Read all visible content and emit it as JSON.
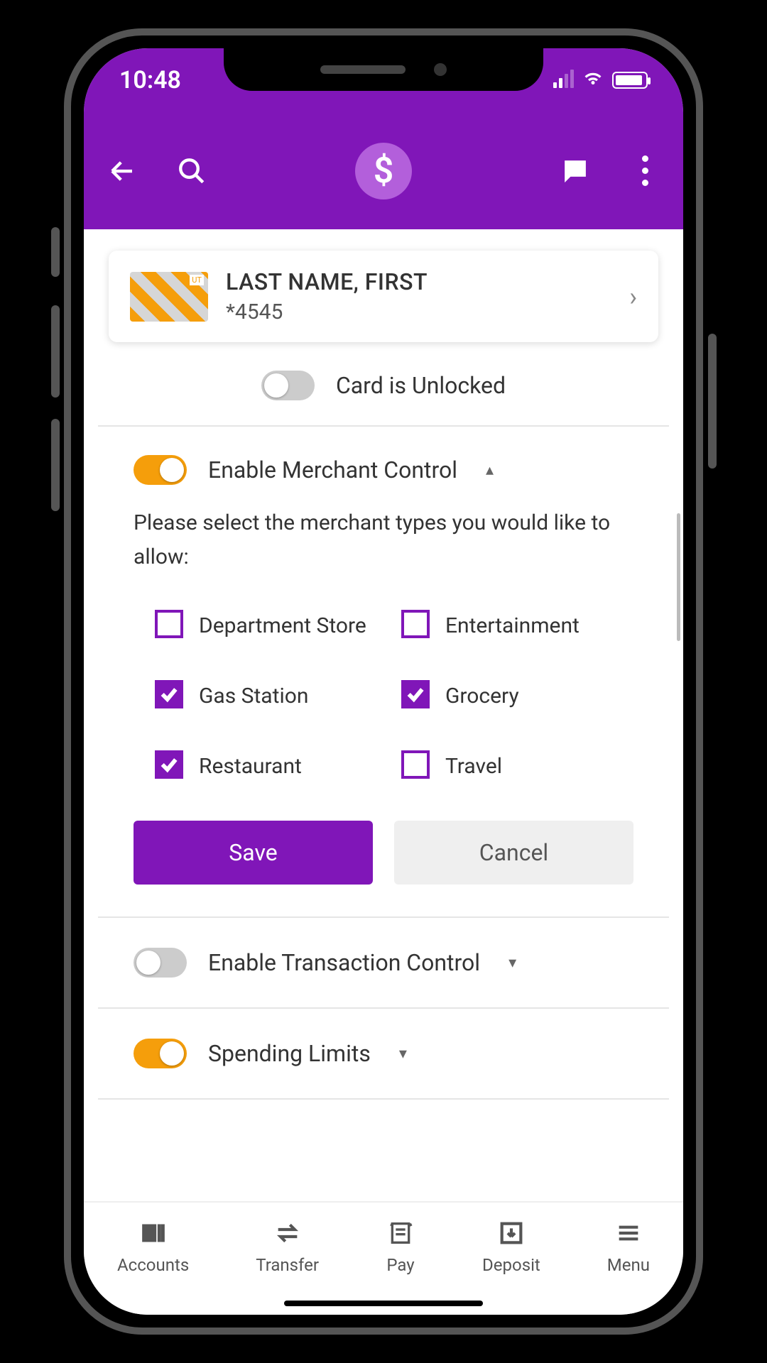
{
  "status": {
    "time": "10:48"
  },
  "card": {
    "name": "LAST NAME, FIRST",
    "number": "*4545"
  },
  "lock": {
    "label": "Card is Unlocked",
    "locked": false
  },
  "merchant_control": {
    "enabled": true,
    "title": "Enable Merchant Control",
    "description": "Please select the merchant types you would like to allow:",
    "options": [
      {
        "label": "Department Store",
        "checked": false
      },
      {
        "label": "Entertainment",
        "checked": false
      },
      {
        "label": "Gas Station",
        "checked": true
      },
      {
        "label": "Grocery",
        "checked": true
      },
      {
        "label": "Restaurant",
        "checked": true
      },
      {
        "label": "Travel",
        "checked": false
      }
    ],
    "save_label": "Save",
    "cancel_label": "Cancel"
  },
  "transaction_control": {
    "enabled": false,
    "title": "Enable Transaction Control"
  },
  "spending_limits": {
    "enabled": true,
    "title": "Spending Limits"
  },
  "nav": {
    "items": [
      {
        "label": "Accounts"
      },
      {
        "label": "Transfer"
      },
      {
        "label": "Pay"
      },
      {
        "label": "Deposit"
      },
      {
        "label": "Menu"
      }
    ]
  }
}
